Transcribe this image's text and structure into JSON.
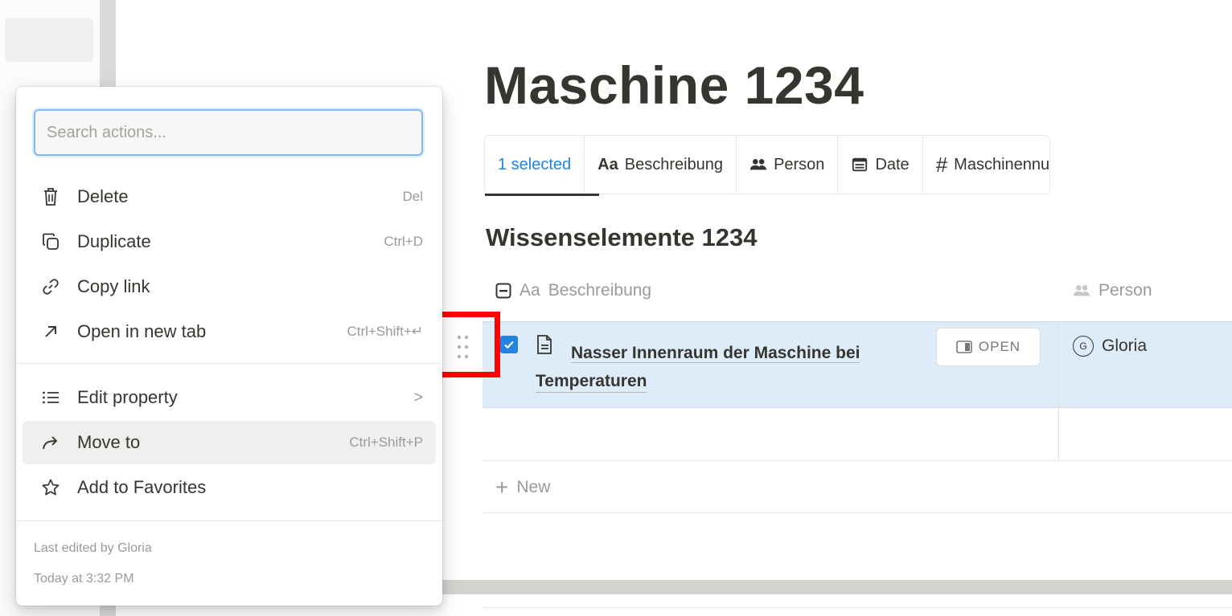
{
  "page": {
    "title": "Maschine 1234"
  },
  "tabs": [
    {
      "label": "1 selected",
      "icon": ""
    },
    {
      "label": "Beschreibung",
      "icon": "Aa"
    },
    {
      "label": "Person",
      "icon": "people-icon"
    },
    {
      "label": "Date",
      "icon": "calendar-icon"
    },
    {
      "label": "Maschinennu",
      "icon": "#"
    }
  ],
  "section": {
    "title": "Wissenselemente 1234"
  },
  "table": {
    "headers": [
      {
        "label": "Beschreibung",
        "icon": "Aa"
      },
      {
        "label": "Person",
        "icon": "people-icon"
      }
    ],
    "row": {
      "title_line1": "Nasser Innenraum der Maschine bei",
      "title_line2": "Temperaturen",
      "open_label": "OPEN",
      "person": "Gloria",
      "avatar_letter": "G"
    },
    "new_label": "New"
  },
  "menu": {
    "search_placeholder": "Search actions...",
    "items": [
      {
        "label": "Delete",
        "shortcut": "Del",
        "icon": "trash-icon"
      },
      {
        "label": "Duplicate",
        "shortcut": "Ctrl+D",
        "icon": "duplicate-icon"
      },
      {
        "label": "Copy link",
        "shortcut": "",
        "icon": "link-icon"
      },
      {
        "label": "Open in new tab",
        "shortcut": "Ctrl+Shift+↵",
        "icon": "arrow-up-right-icon"
      },
      {
        "label": "Edit property",
        "shortcut": ">",
        "icon": "list-icon"
      },
      {
        "label": "Move to",
        "shortcut": "Ctrl+Shift+P",
        "icon": "move-arrow-icon"
      },
      {
        "label": "Add to Favorites",
        "shortcut": "",
        "icon": "star-icon"
      }
    ],
    "last_edited": "Last edited by Gloria",
    "last_edited_time": "Today at 3:32 PM"
  },
  "colors": {
    "accent": "#2383e2",
    "selection_row": "#deecf9",
    "highlight": "#ff0000"
  }
}
